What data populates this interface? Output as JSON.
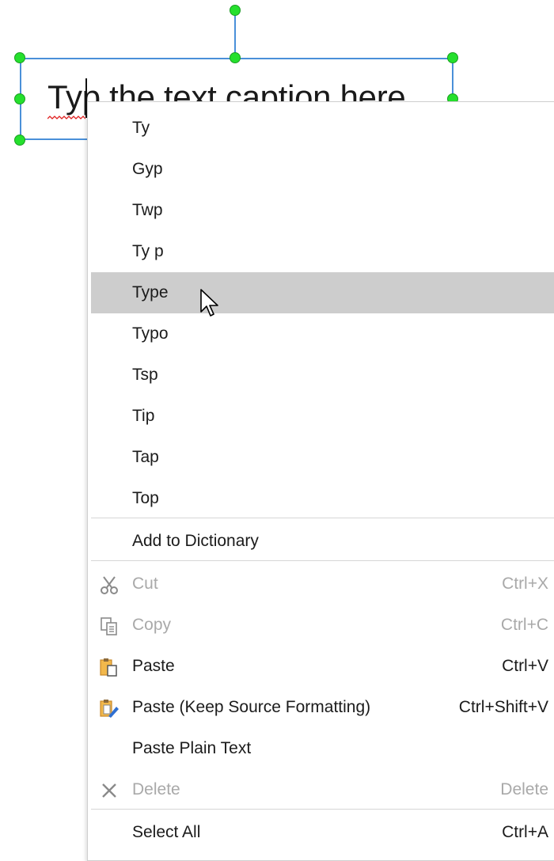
{
  "caption": {
    "text": "Typ the text caption here"
  },
  "menu": {
    "suggestions": [
      "Ty",
      "Gyp",
      "Twp",
      "Ty p",
      "Type",
      "Typo",
      "Tsp",
      "Tip",
      "Tap",
      "Top"
    ],
    "highlighted_suggestion": "Type",
    "add_to_dictionary": "Add to Dictionary",
    "cut": {
      "label": "Cut",
      "shortcut": "Ctrl+X",
      "icon": "scissors-icon"
    },
    "copy": {
      "label": "Copy",
      "shortcut": "Ctrl+C",
      "icon": "copy-icon"
    },
    "paste": {
      "label": "Paste",
      "shortcut": "Ctrl+V",
      "icon": "paste-icon"
    },
    "paste_keep": {
      "label": "Paste (Keep Source Formatting)",
      "shortcut": "Ctrl+Shift+V",
      "icon": "paste-keep-formatting-icon"
    },
    "paste_plain": {
      "label": "Paste Plain Text"
    },
    "delete": {
      "label": "Delete",
      "shortcut": "Delete",
      "icon": "delete-x-icon"
    },
    "select_all": {
      "label": "Select All",
      "shortcut": "Ctrl+A"
    }
  },
  "colors": {
    "selection_border": "#4a90d9",
    "handle": "#25e02d",
    "highlight": "#cdcdcd",
    "disabled_text": "#a9a9a9"
  }
}
